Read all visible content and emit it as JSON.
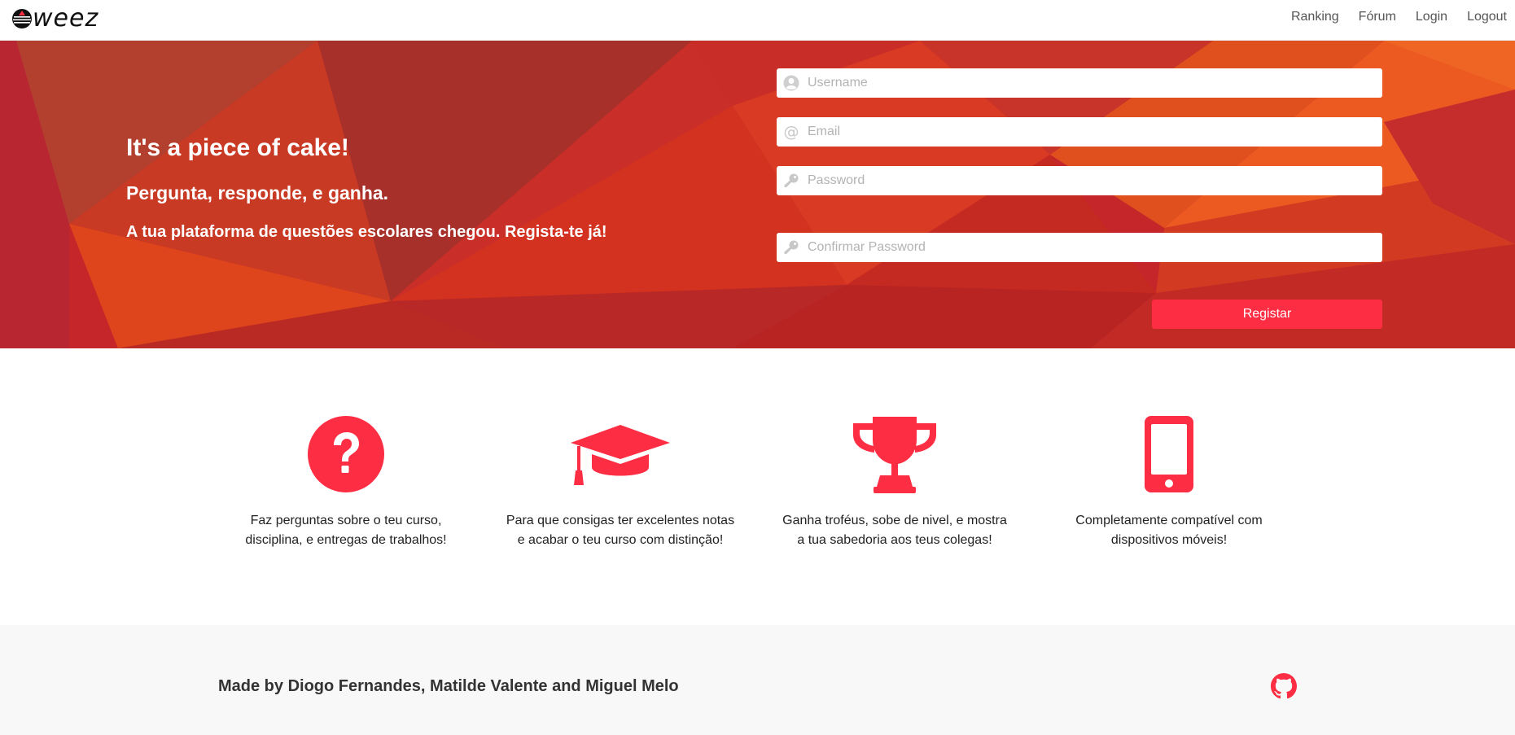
{
  "brand": {
    "logo_text": "weez",
    "logo_icon": "weez-logo-icon"
  },
  "nav": {
    "items": [
      "Ranking",
      "Fórum",
      "Login",
      "Logout"
    ]
  },
  "hero": {
    "title": "It's a piece of cake!",
    "subtitle": "Pergunta, responde, e ganha.",
    "tagline": "A tua plataforma de questões escolares chegou. Regista-te já!",
    "background_colors": [
      "#c4262a",
      "#e2431e",
      "#a92228",
      "#f05a28"
    ]
  },
  "form": {
    "username_placeholder": "Username",
    "email_placeholder": "Email",
    "password_placeholder": "Password",
    "confirm_placeholder": "Confirmar Password",
    "username_icon": "user-icon",
    "email_icon": "at-icon",
    "password_icon": "key-icon",
    "register_label": "Registar",
    "accent": "#fd2d43"
  },
  "features": [
    {
      "icon": "question-circle-icon",
      "line1": "Faz perguntas sobre o teu curso,",
      "line2": "disciplina, e entregas de trabalhos!"
    },
    {
      "icon": "graduation-cap-icon",
      "line1": "Para que consigas ter excelentes notas",
      "line2": "e acabar o teu curso com distinção!"
    },
    {
      "icon": "trophy-icon",
      "line1": "Ganha troféus, sobe de nivel, e mostra",
      "line2": "a tua sabedoria aos teus colegas!"
    },
    {
      "icon": "mobile-phone-icon",
      "line1": "Completamente compatível com",
      "line2": "dispositivos móveis!"
    }
  ],
  "footer": {
    "credits": "Made by Diogo Fernandes, Matilde Valente and Miguel Melo",
    "icon": "github-icon"
  }
}
